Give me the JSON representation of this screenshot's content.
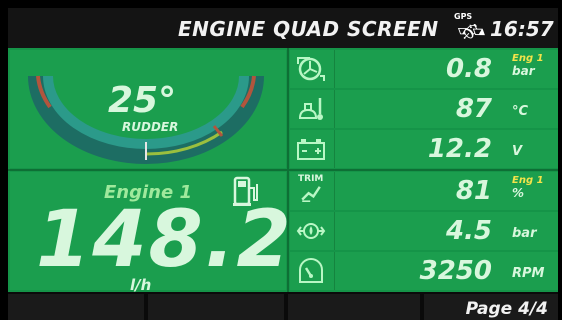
{
  "header": {
    "title": "ENGINE QUAD SCREEN",
    "gps_label": "GPS",
    "time": "16:57"
  },
  "rudder": {
    "value": "25°",
    "label": "RUDDER"
  },
  "engine": {
    "title": "Engine 1",
    "fuel_rate": "148.2",
    "fuel_unit": "l/h"
  },
  "gauges": [
    {
      "icon": "turbo-boost-icon",
      "value": "0.8",
      "unit_top": "Eng 1",
      "unit": "bar"
    },
    {
      "icon": "oil-temperature-icon",
      "value": "87",
      "unit": "°C"
    },
    {
      "icon": "battery-icon",
      "value": "12.2",
      "unit": "V"
    },
    {
      "icon": "trim-icon",
      "icon_label": "TRIM",
      "value": "81",
      "unit_top": "Eng 1",
      "unit": "%"
    },
    {
      "icon": "oil-pressure-icon",
      "value": "4.5",
      "unit": "bar"
    },
    {
      "icon": "tachometer-icon",
      "value": "3250",
      "unit": "RPM"
    }
  ],
  "footer": {
    "page": "Page 4/4"
  },
  "colors": {
    "background": "#159448",
    "panel": "#1b9e4e",
    "accent_yellow": "#f3e34a",
    "text": "#d8f7dd"
  }
}
